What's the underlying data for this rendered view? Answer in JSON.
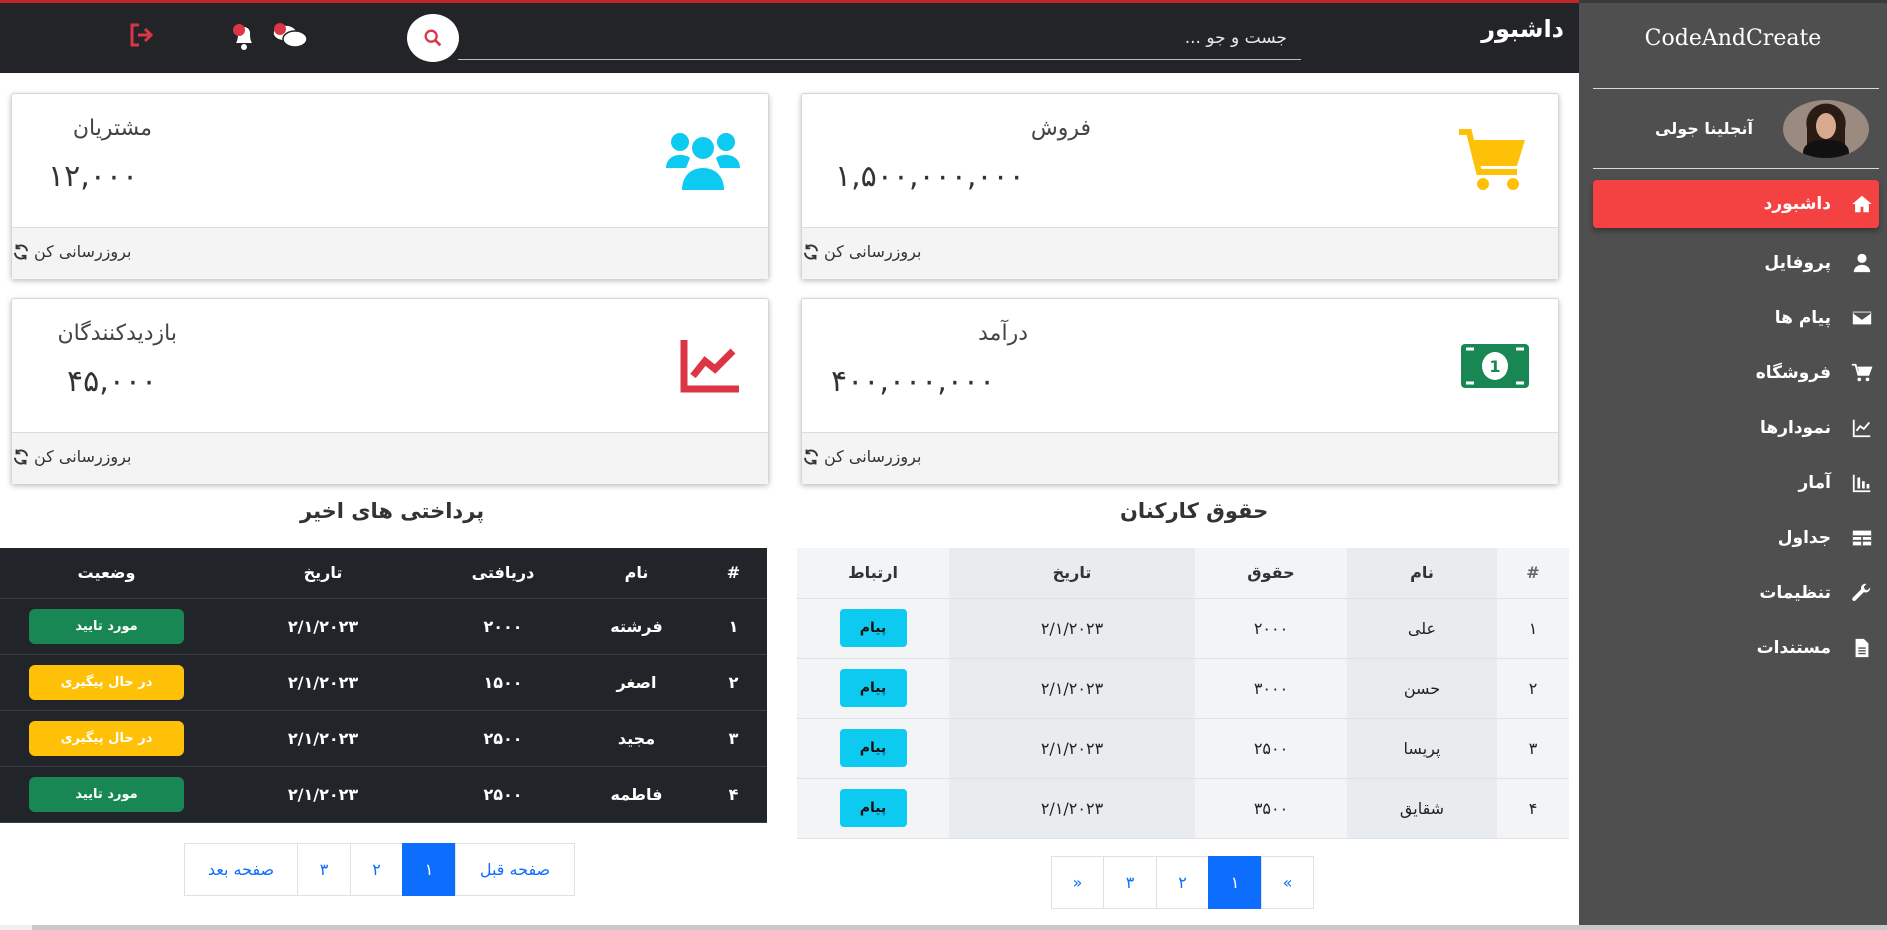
{
  "sidebar": {
    "brand": "CodeAndCreate",
    "user_name": "آنجلینا جولی",
    "items": [
      {
        "label": "داشبورد",
        "icon": "home-icon"
      },
      {
        "label": "پروفایل",
        "icon": "user-icon"
      },
      {
        "label": "پیام ها",
        "icon": "envelope-icon"
      },
      {
        "label": "فروشگاه",
        "icon": "cart-icon"
      },
      {
        "label": "نمودارها",
        "icon": "line-chart-icon"
      },
      {
        "label": "آمار",
        "icon": "bar-chart-icon"
      },
      {
        "label": "جداول",
        "icon": "table-icon"
      },
      {
        "label": "تنظیمات",
        "icon": "wrench-icon"
      },
      {
        "label": "مستندات",
        "icon": "document-icon"
      }
    ]
  },
  "header": {
    "title": "داشبور",
    "search_placeholder": "جست و جو ..."
  },
  "cards": [
    {
      "title": "فروش",
      "value": "۱,۵۰۰,۰۰۰,۰۰۰",
      "refresh": "بروزرسانی کن",
      "icon": "cart-icon",
      "color": "#ffc107"
    },
    {
      "title": "مشتریان",
      "value": "۱۲,۰۰۰",
      "refresh": "بروزرسانی کن",
      "icon": "users-icon",
      "color": "#0dcaf0"
    },
    {
      "title": "درآمد",
      "value": "۴۰۰,۰۰۰,۰۰۰",
      "refresh": "بروزرسانی کن",
      "icon": "money-icon",
      "color": "#198754"
    },
    {
      "title": "بازدیدکنندگان",
      "value": "۴۵,۰۰۰",
      "refresh": "بروزرسانی کن",
      "icon": "line-chart-icon",
      "color": "#dc3545"
    }
  ],
  "salaries": {
    "title": "حقوق کارکنان",
    "headers": [
      "#",
      "نام",
      "حقوق",
      "تاریخ",
      "ارتباط"
    ],
    "rows": [
      {
        "n": "۱",
        "name": "علی",
        "salary": "۲۰۰۰",
        "date": "۲/۱/۲۰۲۳",
        "action": "پیام"
      },
      {
        "n": "۲",
        "name": "حسن",
        "salary": "۳۰۰۰",
        "date": "۲/۱/۲۰۲۳",
        "action": "پیام"
      },
      {
        "n": "۳",
        "name": "پریسا",
        "salary": "۲۵۰۰",
        "date": "۲/۱/۲۰۲۳",
        "action": "پیام"
      },
      {
        "n": "۴",
        "name": "شقایق",
        "salary": "۳۵۰۰",
        "date": "۲/۱/۲۰۲۳",
        "action": "پیام"
      }
    ],
    "pager": [
      "»",
      "۳",
      "۲",
      "۱",
      "«"
    ]
  },
  "payments": {
    "title": "پرداختی های اخیر",
    "headers": [
      "#",
      "نام",
      "دریافتی",
      "تاریخ",
      "وضعیت"
    ],
    "rows": [
      {
        "n": "۱",
        "name": "فرشته",
        "amount": "۲۰۰۰",
        "date": "۲/۱/۲۰۲۳",
        "status": "مورد تایید",
        "tone": "green"
      },
      {
        "n": "۲",
        "name": "اصغر",
        "amount": "۱۵۰۰",
        "date": "۲/۱/۲۰۲۳",
        "status": "در حال پیگیری",
        "tone": "yellow"
      },
      {
        "n": "۳",
        "name": "مجید",
        "amount": "۲۵۰۰",
        "date": "۲/۱/۲۰۲۳",
        "status": "در حال پیگیری",
        "tone": "yellow"
      },
      {
        "n": "۴",
        "name": "فاطمه",
        "amount": "۲۵۰۰",
        "date": "۲/۱/۲۰۲۳",
        "status": "مورد تایید",
        "tone": "green"
      }
    ],
    "pager": [
      "صفحه بعد",
      "۳",
      "۲",
      "۱",
      "صفحه قبل"
    ]
  }
}
